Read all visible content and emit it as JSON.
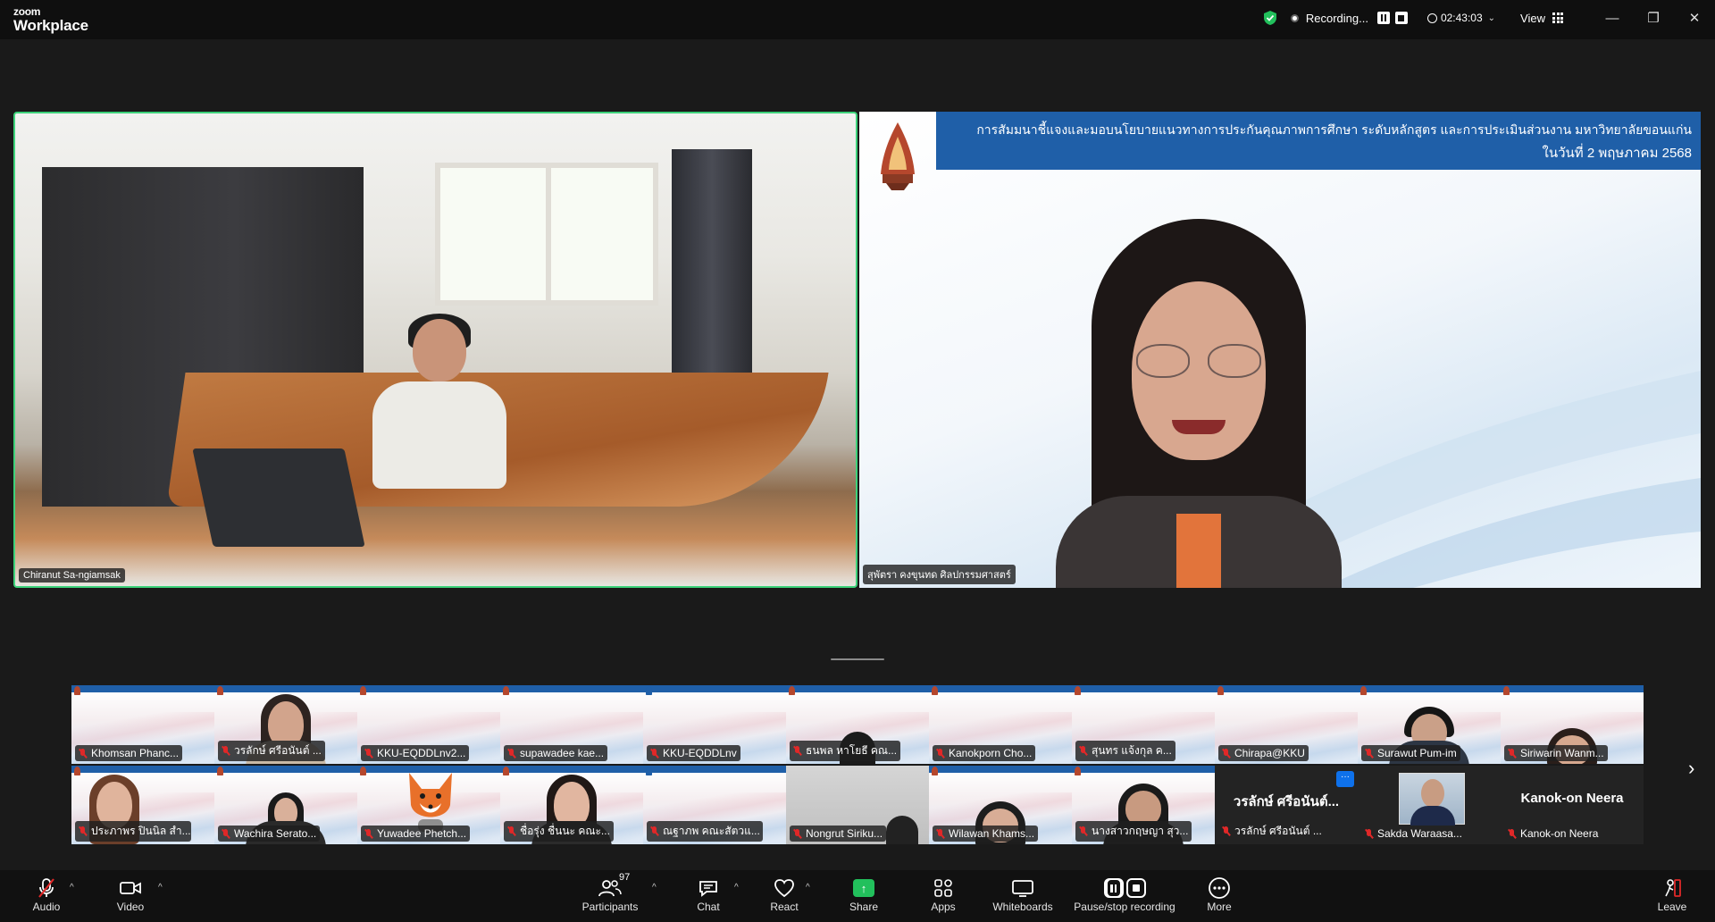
{
  "app": {
    "logo_line1": "zoom",
    "logo_line2": "Workplace"
  },
  "titlebar": {
    "recording_label": "Recording...",
    "timer": "02:43:03",
    "view_label": "View",
    "minimize": "—",
    "restore": "❐",
    "close": "✕"
  },
  "speakers": {
    "left_name": "Chiranut Sa-ngiamsak",
    "right_name": "สุพัตรา คงขุนทด ศิลปกรรมศาสตร์",
    "banner_line1": "การสัมมนาชี้แจงและมอบนโยบายแนวทางการประกันคุณภาพการศึกษา ระดับหลักสูตร และการประเมินส่วนงาน มหาวิทยาลัยขอนแก่น",
    "banner_line2": "ในวันที่ 2 พฤษภาคม 2568"
  },
  "gallery": {
    "row1": [
      {
        "name": "Khomsan Phanc..."
      },
      {
        "name": "วรลักษ์ ศรีอนันต์ ..."
      },
      {
        "name": "KKU-EQDDLnv2..."
      },
      {
        "name": "supawadee kae..."
      },
      {
        "name": "KKU-EQDDLnv"
      },
      {
        "name": "ธนพล หาโยธี คณ..."
      },
      {
        "name": "Kanokporn Cho..."
      },
      {
        "name": "สุนทร แจ้งกุล ค..."
      },
      {
        "name": "Chirapa@KKU"
      },
      {
        "name": "Surawut Pum-im"
      },
      {
        "name": "Siriwarin Wanm..."
      }
    ],
    "row2": [
      {
        "name": "ประภาพร ปินนิล สำ..."
      },
      {
        "name": "Wachira Serato..."
      },
      {
        "name": "Yuwadee Phetch..."
      },
      {
        "name": "ชื่อรุ่ง ชื่นนะ คณะ..."
      },
      {
        "name": "ณฐาภพ คณะสัตวแ..."
      },
      {
        "name": "Nongrut Siriku..."
      },
      {
        "name": "Wilawan Khams..."
      },
      {
        "name": "นางสาวกฤษญา สุว..."
      },
      {
        "name": "วรลักษ์ ศรีอนันต์ ...",
        "big": "วรลักษ์  ศรีอนันต์..."
      },
      {
        "name": "Sakda Waraasa..."
      },
      {
        "name": "Kanok-on Neera",
        "big": "Kanok-on Neera"
      }
    ],
    "menu_dots": "···",
    "next_arrow": "›"
  },
  "toolbar": {
    "audio": "Audio",
    "video": "Video",
    "participants": "Participants",
    "participants_count": "97",
    "chat": "Chat",
    "react": "React",
    "share": "Share",
    "apps": "Apps",
    "whiteboards": "Whiteboards",
    "record": "Pause/stop recording",
    "more": "More",
    "leave": "Leave",
    "caret": "^"
  },
  "colors": {
    "active_speaker_border": "#3dd27a",
    "share_green": "#22c05c",
    "muted_red": "#e02828",
    "banner_blue": "#1f5fa8"
  }
}
